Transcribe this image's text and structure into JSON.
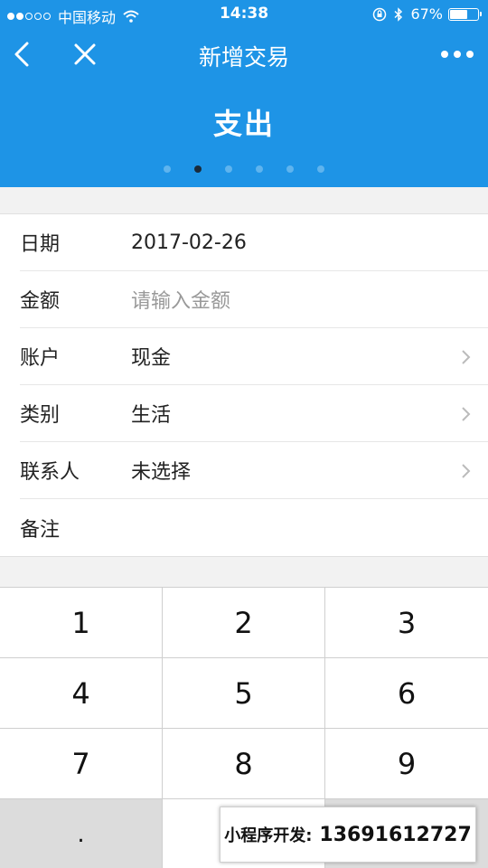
{
  "status_bar": {
    "carrier": "中国移动",
    "time": "14:38",
    "battery_percent": "67%",
    "battery_level": 0.67,
    "signal_bars_filled": 2,
    "signal_bars_total": 5
  },
  "nav": {
    "title": "新增交易",
    "back_icon": "chevron-left-icon",
    "close_icon": "close-icon",
    "more_icon": "more-dots-icon"
  },
  "transaction_type": {
    "title": "支出",
    "page_count": 6,
    "active_page": 2
  },
  "form": {
    "date": {
      "label": "日期",
      "value": "2017-02-26"
    },
    "amount": {
      "label": "金额",
      "placeholder": "请输入金额"
    },
    "account": {
      "label": "账户",
      "value": "现金"
    },
    "category": {
      "label": "类别",
      "value": "生活"
    },
    "contact": {
      "label": "联系人",
      "value": "未选择"
    },
    "note": {
      "label": "备注",
      "value": ""
    }
  },
  "keypad": {
    "keys": [
      "1",
      "2",
      "3",
      "4",
      "5",
      "6",
      "7",
      "8",
      "9",
      "."
    ]
  },
  "watermark": {
    "label": "小程序开发:",
    "phone": "13691612727"
  },
  "colors": {
    "header_blue": "#1e94e6",
    "pager_inactive": "#5fb4ee",
    "pager_active": "#1a2a3a"
  }
}
